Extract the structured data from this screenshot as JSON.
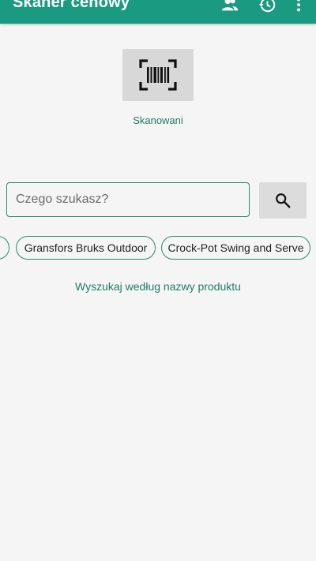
{
  "app_bar": {
    "title": "Skaner cenowy",
    "background_color": "#1a9a80",
    "icons": [
      "account-icon",
      "history-icon",
      "more-vert-icon"
    ]
  },
  "scan": {
    "label": "Skanowani",
    "icon": "barcode-scan-icon"
  },
  "search": {
    "placeholder": "Czego szukasz?",
    "value": "",
    "button_icon": "search-icon"
  },
  "chips": [
    {
      "label": ""
    },
    {
      "label": "Gransfors Bruks Outdoor"
    },
    {
      "label": "Crock-Pot Swing and Serve"
    }
  ],
  "search_by_name_link": "Wyszukaj według nazwy produktu",
  "colors": {
    "accent": "#1f7a66",
    "outline": "#2a8a74",
    "background": "#f5f5f5"
  }
}
